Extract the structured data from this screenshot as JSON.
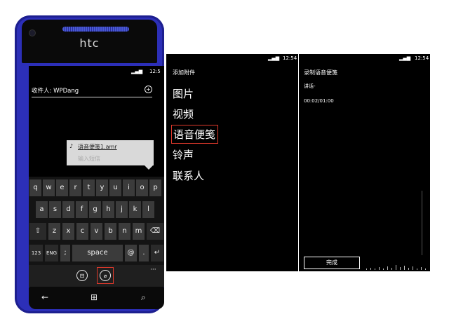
{
  "phone": {
    "brand": "htc",
    "status_time": "12:5",
    "recipient_label": "收件人: WPDang",
    "attachment_name": "语音便笺1.amr",
    "message_placeholder": "输入短信",
    "keyboard": {
      "row1": [
        "q",
        "w",
        "e",
        "r",
        "t",
        "y",
        "u",
        "i",
        "o",
        "p"
      ],
      "row2": [
        "a",
        "s",
        "d",
        "f",
        "g",
        "h",
        "j",
        "k",
        "l"
      ],
      "row3": [
        "z",
        "x",
        "c",
        "v",
        "b",
        "n",
        "m"
      ],
      "shift": "⇧",
      "backspace": "⌫",
      "num_key": "123",
      "lang_key": "ENG",
      "semicolon_key": ";",
      "space_key": "space",
      "at_key": "@",
      "period_key": ".",
      "enter_key": "↵",
      "more": "···"
    },
    "nav": {
      "back": "←",
      "start": "⊞",
      "search": "⌕"
    }
  },
  "attach_menu": {
    "status_time": "12:54",
    "title": "添加附件",
    "items": [
      "图片",
      "视频",
      "语音便笺",
      "铃声",
      "联系人"
    ],
    "highlighted_index": 2
  },
  "record_panel": {
    "status_time": "12:54",
    "title": "录制语音便笺",
    "speak_label": "讲话-",
    "timer": "00:02/01:00",
    "done_button": "完成"
  },
  "colors": {
    "highlight": "#e0392b",
    "phone_body": "#2c2fb8"
  }
}
